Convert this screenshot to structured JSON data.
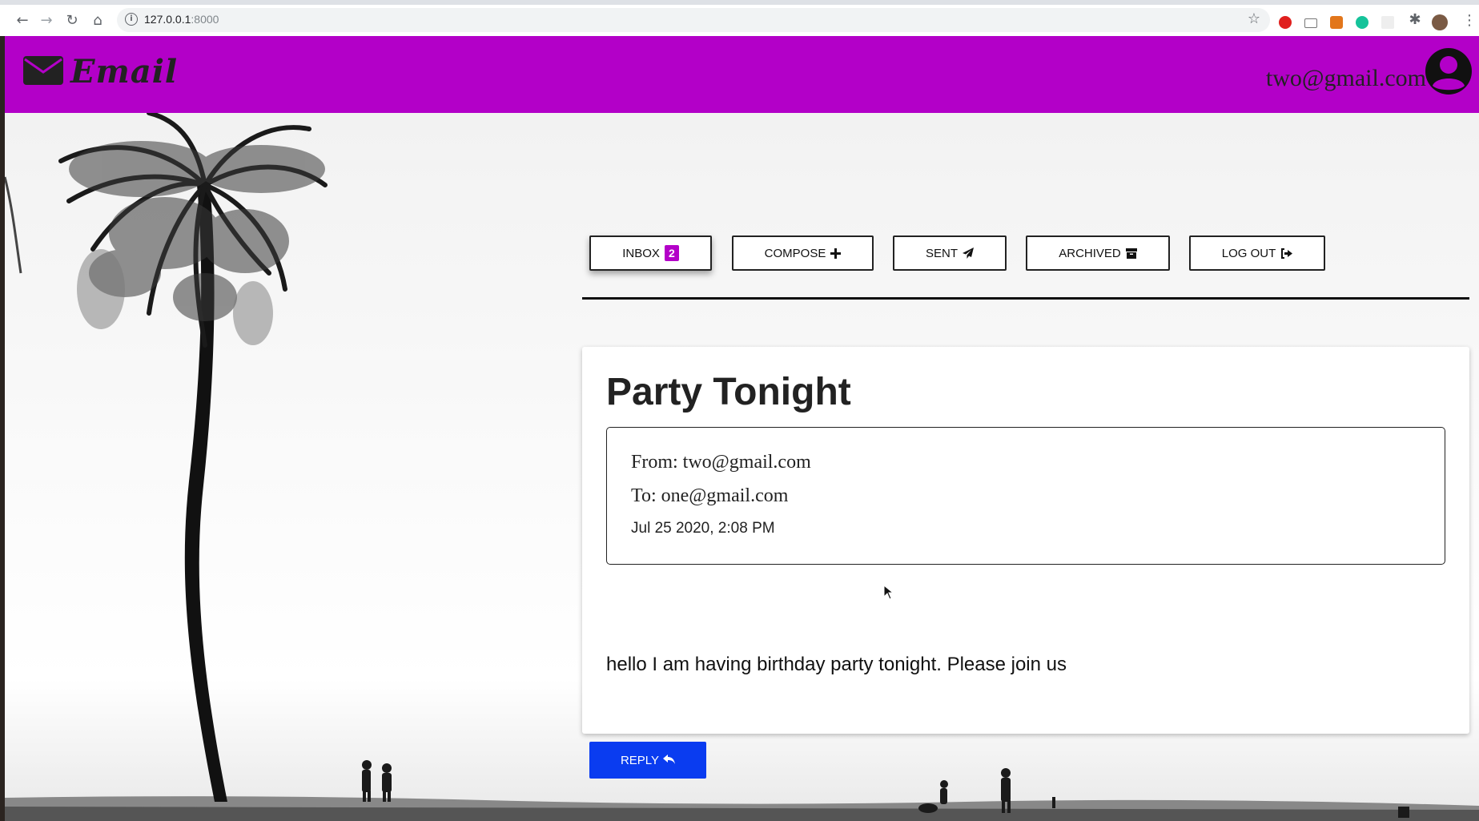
{
  "browser": {
    "url_host": "127.0.0.1",
    "url_port": ":8000",
    "icons": [
      "back-icon",
      "forward-icon",
      "reload-icon",
      "home-icon",
      "info-icon",
      "star-icon",
      "extensions-icon",
      "menu-icon"
    ]
  },
  "header": {
    "logo_text": "Email",
    "user_email": "two@gmail.com"
  },
  "nav": {
    "inbox_label": "INBOX",
    "inbox_count": "2",
    "compose_label": "COMPOSE",
    "sent_label": "SENT",
    "archived_label": "ARCHIVED",
    "logout_label": "LOG OUT"
  },
  "email": {
    "subject": "Party Tonight",
    "from": "From: two@gmail.com",
    "to": "To: one@gmail.com",
    "timestamp": "Jul 25 2020, 2:08 PM",
    "body": "hello I am having birthday party tonight. Please join us"
  },
  "actions": {
    "reply_label": "REPLY"
  },
  "colors": {
    "brand": "#b300c8",
    "reply_button": "#0a3cf0",
    "text": "#222222"
  }
}
